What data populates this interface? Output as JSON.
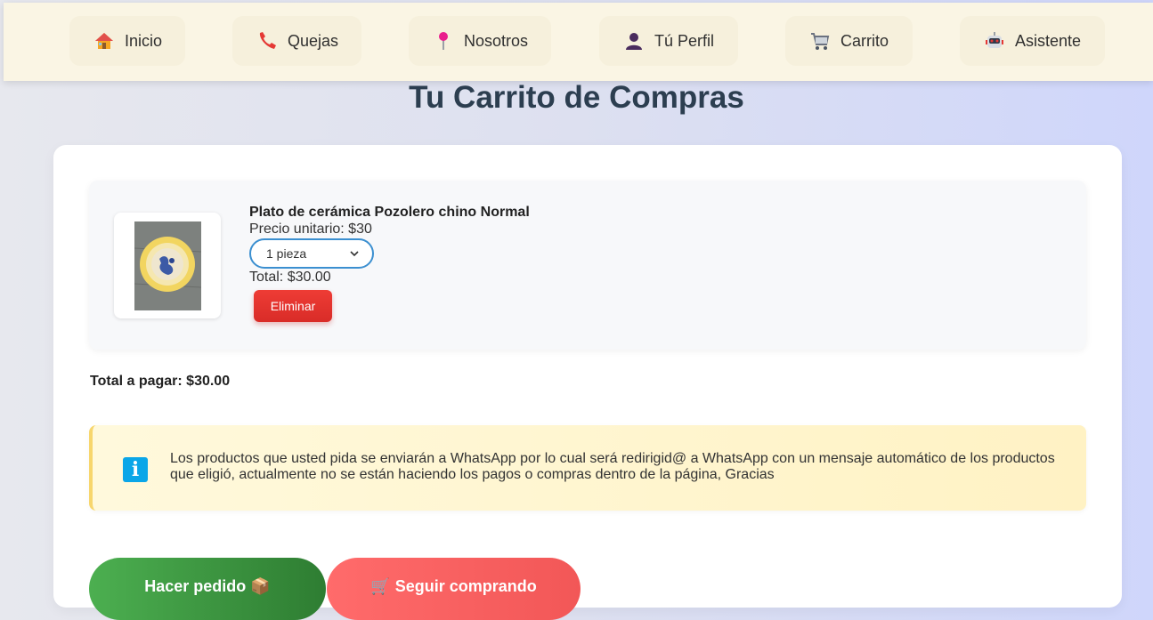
{
  "nav": {
    "items": [
      {
        "label": "Inicio",
        "icon": "house-icon"
      },
      {
        "label": "Quejas",
        "icon": "phone-icon"
      },
      {
        "label": "Nosotros",
        "icon": "pin-icon"
      },
      {
        "label": "Tú Perfil",
        "icon": "user-icon"
      },
      {
        "label": "Carrito",
        "icon": "cart-icon"
      },
      {
        "label": "Asistente",
        "icon": "robot-icon"
      }
    ]
  },
  "page": {
    "title": "Tu Carrito de Compras"
  },
  "cart": {
    "items": [
      {
        "name": "Plato de cerámica Pozolero chino Normal",
        "unit_price": "Precio unitario: $30",
        "quantity": "1 pieza",
        "total": "Total: $30.00",
        "remove_label": "Eliminar"
      }
    ],
    "grand_total": "Total a pagar: $30.00"
  },
  "notice": {
    "text": "Los productos que usted pida se enviarán a WhatsApp por lo cual será redirigid@ a WhatsApp con un mensaje automático de los productos que eligió, actualmente no se están haciendo los pagos o compras dentro de la página, Gracias"
  },
  "actions": {
    "order_label": "Hacer pedido 📦",
    "continue_label": "🛒 Seguir comprando"
  },
  "colors": {
    "remove": "#e53935",
    "order": "#43a047",
    "continue": "#ff6b6b",
    "select_border": "#3b8fd0",
    "info": "#0aa6e8"
  }
}
